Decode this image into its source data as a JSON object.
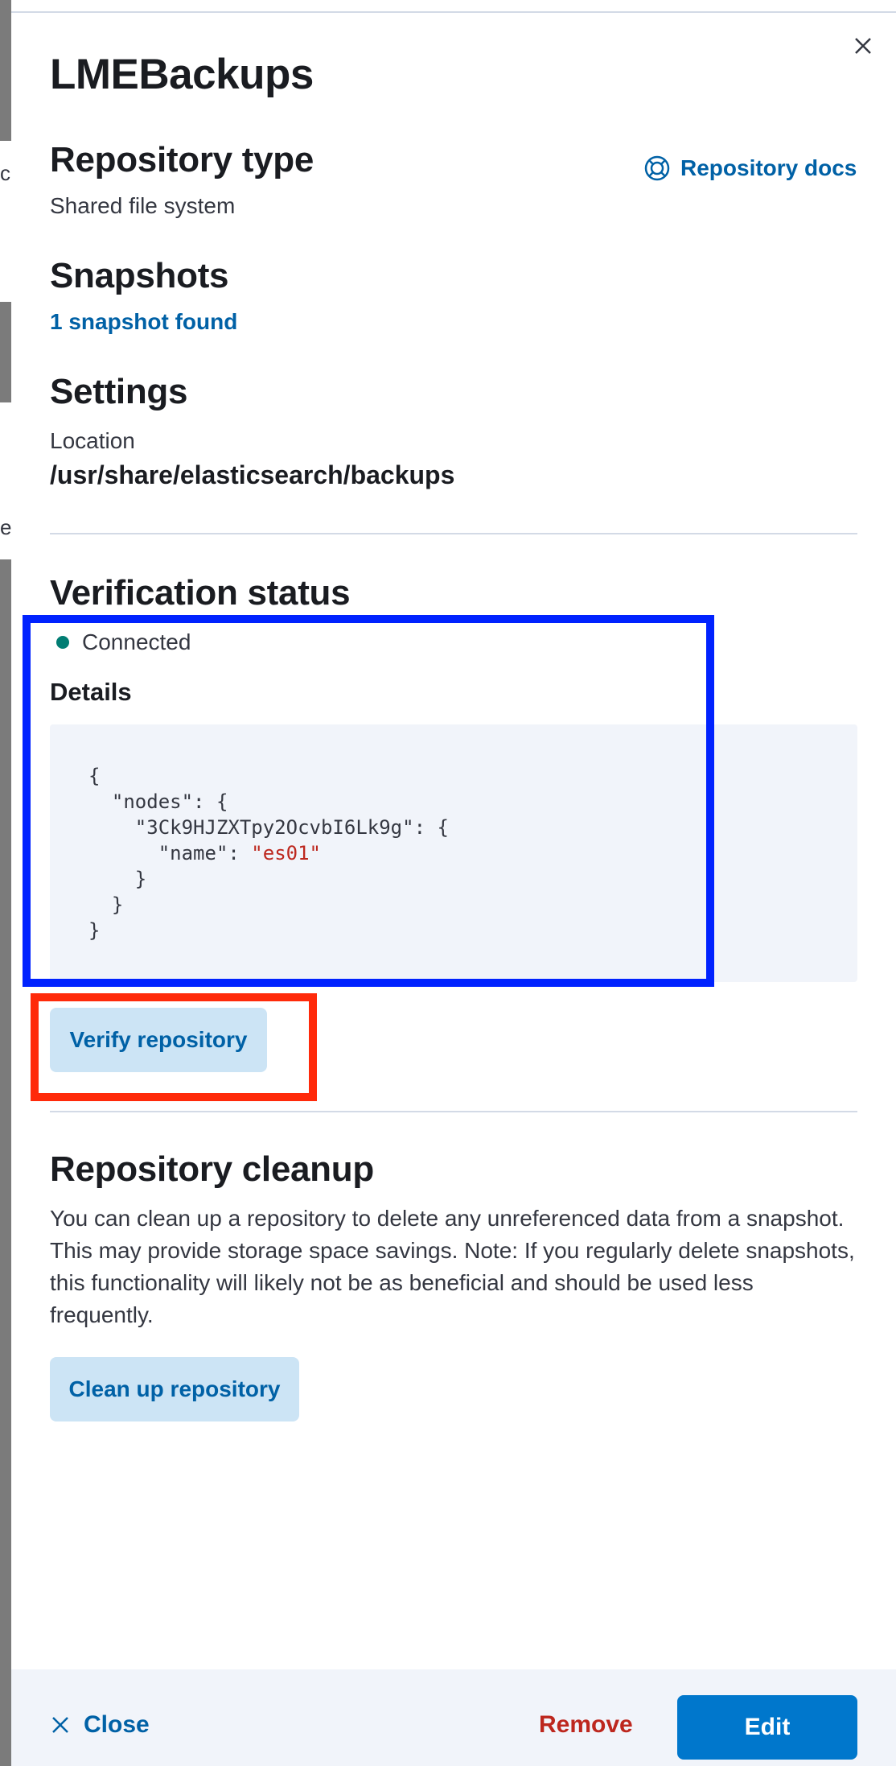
{
  "background": {
    "fragment_1": "c",
    "fragment_2": "e"
  },
  "flyout": {
    "title": "LMEBackups",
    "repository_type": {
      "heading": "Repository type",
      "value": "Shared file system",
      "docs_link": "Repository docs"
    },
    "snapshots": {
      "heading": "Snapshots",
      "link": "1 snapshot found"
    },
    "settings": {
      "heading": "Settings",
      "location_label": "Location",
      "location_value": "/usr/share/elasticsearch/backups"
    },
    "verification": {
      "heading": "Verification status",
      "status": "Connected",
      "status_color": "#017d73",
      "details_heading": "Details",
      "code_lines": [
        "{",
        "  \"nodes\": {",
        "    \"3Ck9HJZXTpy2OcvbI6Lk9g\": {",
        "      \"name\": ",
        "    }",
        "  }",
        "}"
      ],
      "code_string_value": "\"es01\"",
      "verify_button": "Verify repository"
    },
    "cleanup": {
      "heading": "Repository cleanup",
      "description": "You can clean up a repository to delete any unreferenced data from a snapshot. This may provide storage space savings. Note: If you regularly delete snapshots, this functionality will likely not be as beneficial and should be used less frequently.",
      "button": "Clean up repository"
    },
    "footer": {
      "close_label": "Close",
      "remove_label": "Remove",
      "edit_label": "Edit"
    }
  },
  "colors": {
    "link": "#0061a6",
    "danger": "#bd271e",
    "primary": "#0077cc",
    "annotation_blue": "#0022ff",
    "annotation_red": "#ff2a0a"
  }
}
